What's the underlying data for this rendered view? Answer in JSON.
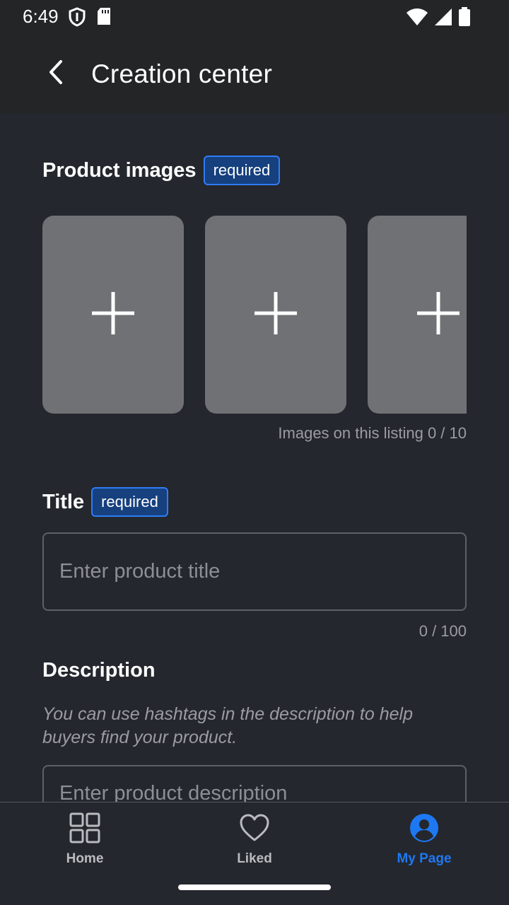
{
  "status_bar": {
    "time": "6:49",
    "left_icons": [
      "shield-icon",
      "sd-card-icon"
    ],
    "right_icons": [
      "wifi-icon",
      "signal-icon",
      "battery-icon"
    ]
  },
  "app_bar": {
    "title": "Creation center",
    "back_icon": "back-arrow-icon"
  },
  "images_section": {
    "label": "Product images",
    "badge": "required",
    "slot_icon": "plus-icon",
    "counter": "Images on this listing 0 / 10"
  },
  "title_section": {
    "label": "Title",
    "badge": "required",
    "placeholder": "Enter product title",
    "value": "",
    "counter": "0 / 100"
  },
  "description_section": {
    "label": "Description",
    "hint": "You can use hashtags in the description to help buyers find your product.",
    "placeholder": "Enter product description",
    "value": ""
  },
  "bottom_nav": {
    "items": [
      {
        "label": "Home",
        "icon": "grid-icon",
        "active": false
      },
      {
        "label": "Liked",
        "icon": "heart-icon",
        "active": false
      },
      {
        "label": "My Page",
        "icon": "account-icon",
        "active": true
      }
    ]
  },
  "colors": {
    "background": "#24272d",
    "bar": "#242527",
    "accent": "#1e78f2",
    "badge_bg": "#16407e",
    "slot": "#707174"
  }
}
